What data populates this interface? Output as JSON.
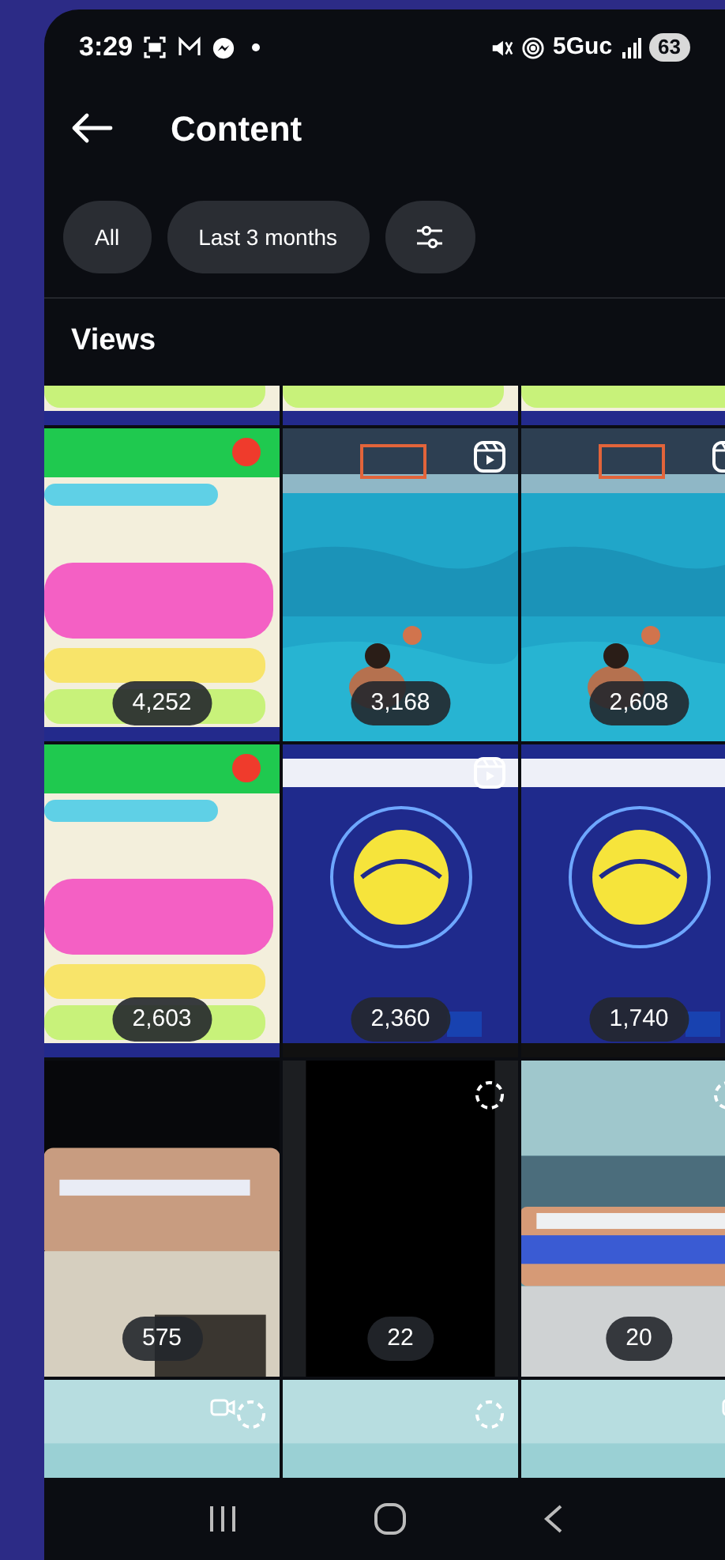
{
  "status_bar": {
    "time": "3:29",
    "network": "5Guc",
    "battery": "63"
  },
  "header": {
    "title": "Content"
  },
  "filters": [
    {
      "kind": "chip",
      "label": "All"
    },
    {
      "kind": "chip",
      "label": "Last 3 months"
    },
    {
      "kind": "icon"
    }
  ],
  "section": {
    "title": "Views"
  },
  "grid": [
    {
      "tiles": [
        {
          "kind": "post"
        },
        {
          "kind": "post"
        },
        {
          "kind": "post"
        }
      ]
    },
    {
      "tiles": [
        {
          "kind": "post",
          "views": "4,252"
        },
        {
          "kind": "reel",
          "views": "3,168"
        },
        {
          "kind": "reel",
          "views": "2,608"
        }
      ]
    },
    {
      "tiles": [
        {
          "kind": "post",
          "views": "2,603"
        },
        {
          "kind": "reel",
          "views": "2,360"
        },
        {
          "kind": "post",
          "views": "1,740"
        }
      ]
    },
    {
      "tiles": [
        {
          "kind": "post",
          "views": "575"
        },
        {
          "kind": "loading",
          "views": "22"
        },
        {
          "kind": "loading",
          "views": "20"
        }
      ]
    },
    {
      "tiles": [
        {
          "kind": "video_loading"
        },
        {
          "kind": "loading"
        },
        {
          "kind": "video"
        }
      ]
    }
  ]
}
